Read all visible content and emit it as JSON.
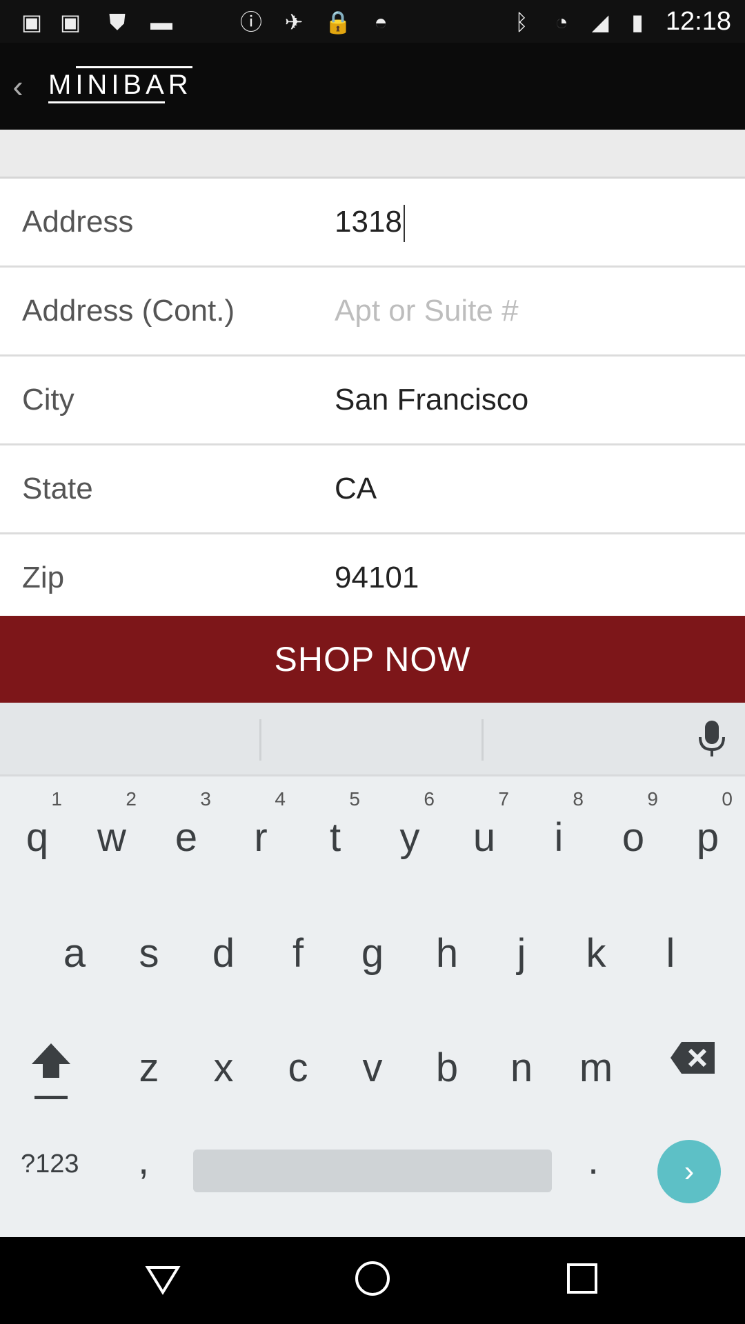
{
  "status_bar": {
    "time": "12:18",
    "left_icons": [
      "photo-icon",
      "photo-icon",
      "shield-icon",
      "message-icon",
      "info-icon",
      "satellite-icon",
      "lock-icon",
      "android-icon"
    ],
    "right_icons": [
      "bluetooth-icon",
      "wifi-icon",
      "signal-icon",
      "battery-icon"
    ]
  },
  "app": {
    "logo_text": "MINIBAR"
  },
  "form": {
    "rows": [
      {
        "label": "Address",
        "value": "1318",
        "placeholder": ""
      },
      {
        "label": "Address (Cont.)",
        "value": "",
        "placeholder": "Apt or Suite #"
      },
      {
        "label": "City",
        "value": "San Francisco",
        "placeholder": ""
      },
      {
        "label": "State",
        "value": "CA",
        "placeholder": ""
      },
      {
        "label": "Zip",
        "value": "94101",
        "placeholder": ""
      }
    ]
  },
  "shop_button": "SHOP NOW",
  "keyboard": {
    "row1": [
      {
        "key": "q",
        "num": "1"
      },
      {
        "key": "w",
        "num": "2"
      },
      {
        "key": "e",
        "num": "3"
      },
      {
        "key": "r",
        "num": "4"
      },
      {
        "key": "t",
        "num": "5"
      },
      {
        "key": "y",
        "num": "6"
      },
      {
        "key": "u",
        "num": "7"
      },
      {
        "key": "i",
        "num": "8"
      },
      {
        "key": "o",
        "num": "9"
      },
      {
        "key": "p",
        "num": "0"
      }
    ],
    "row2": [
      "a",
      "s",
      "d",
      "f",
      "g",
      "h",
      "j",
      "k",
      "l"
    ],
    "row3": [
      "z",
      "x",
      "c",
      "v",
      "b",
      "n",
      "m"
    ],
    "symbols_key": "?123",
    "comma_key": ",",
    "period_key": "."
  },
  "colors": {
    "accent_red": "#7d1619",
    "enter_teal": "#5dc0c6"
  }
}
